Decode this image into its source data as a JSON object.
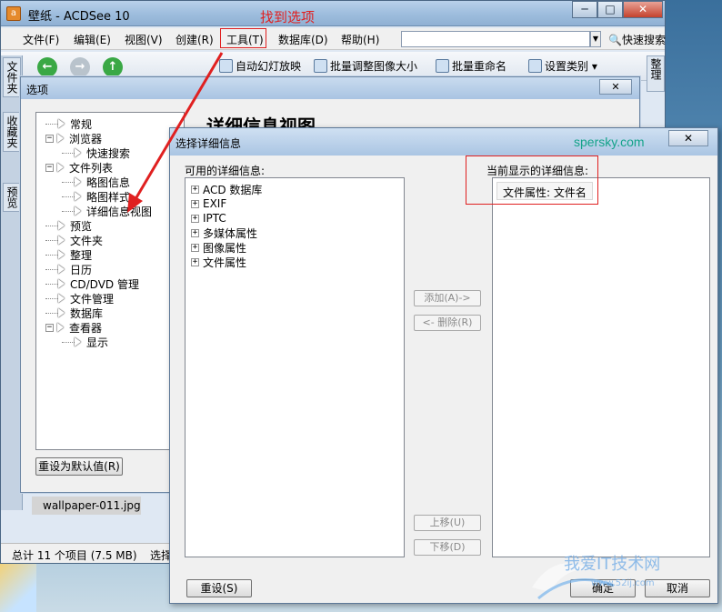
{
  "window": {
    "title": "壁纸 - ACDSee 10",
    "icon": "acdsee-app-icon",
    "caption_buttons": [
      "─",
      "□",
      "✕"
    ]
  },
  "menu": {
    "items": [
      "文件(F)",
      "编辑(E)",
      "视图(V)",
      "创建(R)",
      "工具(T)",
      "数据库(D)",
      "帮助(H)"
    ],
    "quick_search": "快速搜索",
    "search_value": ""
  },
  "toolbar": {
    "items": [
      "自动幻灯放映",
      "批量调整图像大小",
      "批量重命名",
      "设置类别 ▾"
    ]
  },
  "side_tabs": {
    "left": [
      "文件夹",
      "收藏夹",
      "预览"
    ],
    "right": "整理"
  },
  "annotation": {
    "text": "找到选项",
    "color": "#e02020"
  },
  "thumbnail": {
    "filename": "wallpaper-011.jpg"
  },
  "status_bar": {
    "total": "总计 11 个项目 (7.5 MB)",
    "selected": "选择"
  },
  "options_dialog": {
    "title": "选项",
    "close": "✕",
    "heading": "详细信息视图",
    "tree": [
      {
        "label": "常规",
        "level": 0,
        "expander": ""
      },
      {
        "label": "浏览器",
        "level": 0,
        "expander": "−"
      },
      {
        "label": "快速搜索",
        "level": 1,
        "expander": ""
      },
      {
        "label": "文件列表",
        "level": 0,
        "expander": "−"
      },
      {
        "label": "略图信息",
        "level": 1,
        "expander": ""
      },
      {
        "label": "略图样式",
        "level": 1,
        "expander": ""
      },
      {
        "label": "详细信息视图",
        "level": 1,
        "expander": ""
      },
      {
        "label": "预览",
        "level": 0,
        "expander": ""
      },
      {
        "label": "文件夹",
        "level": 0,
        "expander": ""
      },
      {
        "label": "整理",
        "level": 0,
        "expander": ""
      },
      {
        "label": "日历",
        "level": 0,
        "expander": ""
      },
      {
        "label": "CD/DVD 管理",
        "level": 0,
        "expander": ""
      },
      {
        "label": "文件管理",
        "level": 0,
        "expander": ""
      },
      {
        "label": "数据库",
        "level": 0,
        "expander": ""
      },
      {
        "label": "查看器",
        "level": 0,
        "expander": "−"
      },
      {
        "label": "显示",
        "level": 1,
        "expander": ""
      }
    ],
    "reset_default": "重设为默认值(R)"
  },
  "select_dialog": {
    "title": "选择详细信息",
    "watermark": "spersky.com",
    "close": "✕",
    "available_label": "可用的详细信息:",
    "available_items": [
      "ACD 数据库",
      "EXIF",
      "IPTC",
      "多媒体属性",
      "图像属性",
      "文件属性"
    ],
    "current_label": "当前显示的详细信息:",
    "current_items": [
      "文件属性: 文件名"
    ],
    "add_button": "添加(A)->",
    "remove_button": "<- 删除(R)",
    "up_button": "上移(U)",
    "down_button": "下移(D)",
    "reset_button": "重设(S)",
    "ok_button": "确定",
    "cancel_button": "取消"
  },
  "logo_watermark": {
    "text": "我爱IT技术网",
    "sub": "www.52ij.com"
  }
}
